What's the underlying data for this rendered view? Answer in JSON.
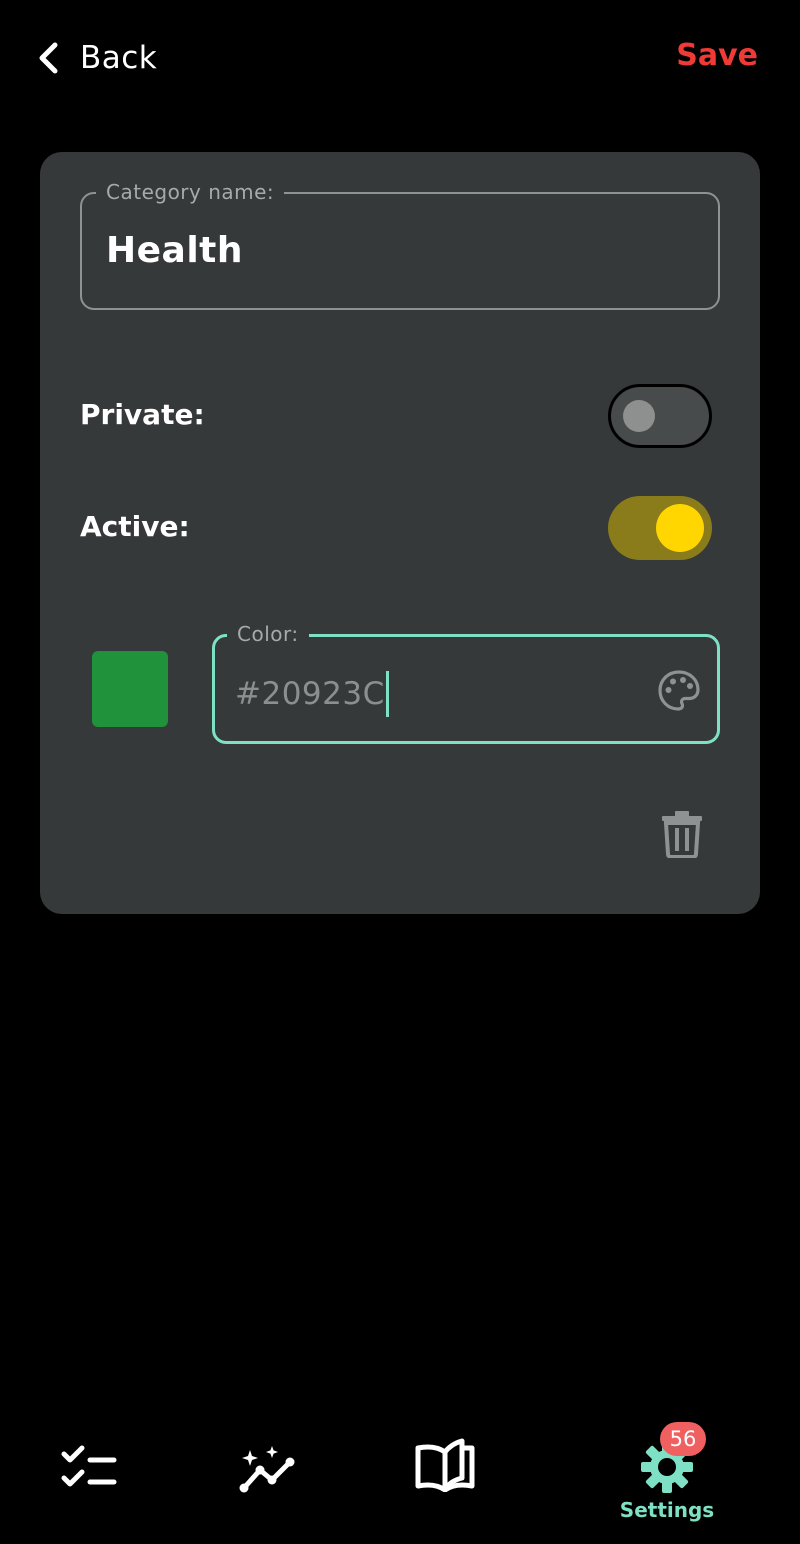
{
  "header": {
    "back_label": "Back",
    "save_label": "Save"
  },
  "category_form": {
    "name_field_label": "Category name:",
    "name_value": "Health",
    "private_label": "Private:",
    "private_on": false,
    "active_label": "Active:",
    "active_on": true,
    "color_field_label": "Color:",
    "color_value": "#20923C",
    "swatch_color": "#20923C",
    "palette_icon": "palette-icon",
    "delete_icon": "trash-icon"
  },
  "bottom_nav": {
    "items": [
      {
        "icon": "checklist-icon",
        "label": ""
      },
      {
        "icon": "trend-sparkle-icon",
        "label": ""
      },
      {
        "icon": "open-book-icon",
        "label": ""
      },
      {
        "icon": "gear-icon",
        "label": "Settings",
        "badge": "56",
        "active": true
      }
    ]
  },
  "colors": {
    "accent": "#7ee0c4",
    "save": "#f03a36",
    "badge": "#f06060",
    "toggle_on_track": "#8a7c1a",
    "toggle_on_knob": "#ffd600",
    "card": "#363939",
    "background": "#000000"
  }
}
